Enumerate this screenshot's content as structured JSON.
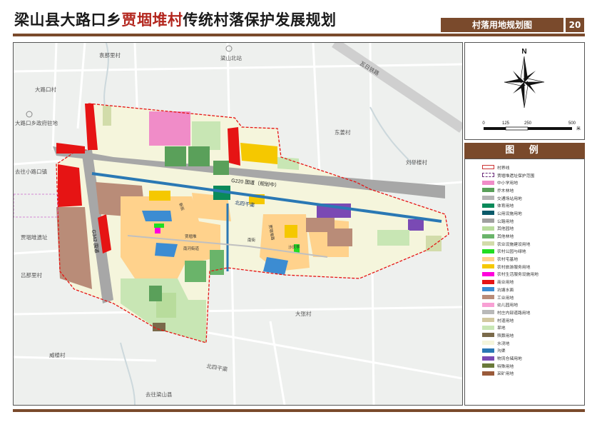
{
  "header": {
    "title_prefix": "梁山县大路口乡",
    "title_highlight": "贾堌堆村",
    "title_suffix": "传统村落保护发展规划",
    "map_name": "村落用地规划图",
    "page_number": "20"
  },
  "colors": {
    "brand": "#7a4a2c",
    "title_highlight": "#b3261e"
  },
  "map": {
    "labels": {
      "yuanna": "袁那里村",
      "lianshan_north": "梁山北站",
      "wagu": "瓦日铁路",
      "daluko_village": "大路口村",
      "gov": "大路口乡政府驻地",
      "dongjiang": "东姜村",
      "liuju": "刘举楼村",
      "to_daluko_town": "去往小路口镇",
      "g220": "G220 国道（规划中）",
      "beisi": "北四干渠",
      "g342": "G342 国道",
      "jiagudui_site": "贾堌堆遗址",
      "lvna": "吕那里村",
      "shaqing": "沙庆李",
      "dazhang": "大张村",
      "weilou": "威楼村",
      "beiwu": "北四干渠",
      "to_lianshan": "去往梁山县",
      "jiagu_village": "贾堌堆",
      "nanhe_road": "南河街道",
      "nanjie": "南街",
      "xinjie": "新街",
      "road_small": "贾堌堆路"
    }
  },
  "compass": {
    "north": "N",
    "scale_ticks": [
      "0",
      "125",
      "250",
      "500"
    ],
    "scale_unit": "米"
  },
  "legend": {
    "heading": "图  例",
    "items": [
      {
        "label": "村界线",
        "color": "#ffffff",
        "style": "boundary-solid"
      },
      {
        "label": "贾堌堆遗址保护范围",
        "color": "#ffffff",
        "style": "boundary-dashed"
      },
      {
        "label": "中小学用地",
        "color": "#f08cc8",
        "style": "fill"
      },
      {
        "label": "乔木林地",
        "color": "#5aa05a",
        "style": "fill"
      },
      {
        "label": "交通场站用地",
        "color": "#b4b4b4",
        "style": "fill"
      },
      {
        "label": "体育用地",
        "color": "#0a8a5a",
        "style": "fill"
      },
      {
        "label": "公用设施用地",
        "color": "#0a5a6a",
        "style": "fill"
      },
      {
        "label": "公路用地",
        "color": "#a0a0a0",
        "style": "fill"
      },
      {
        "label": "其他园地",
        "color": "#b8dc9c",
        "style": "fill"
      },
      {
        "label": "其他林地",
        "color": "#6ab46a",
        "style": "fill"
      },
      {
        "label": "农业设施建设用地",
        "color": "#d2dcaa",
        "style": "fill"
      },
      {
        "label": "农村公园与绿地",
        "color": "#22dd22",
        "style": "fill"
      },
      {
        "label": "农村宅基地",
        "color": "#ffd28c",
        "style": "fill"
      },
      {
        "label": "农村旅游服务用地",
        "color": "#f5c800",
        "style": "fill"
      },
      {
        "label": "农村生活服务设施用地",
        "color": "#ff00dc",
        "style": "fill"
      },
      {
        "label": "商业用地",
        "color": "#e61414",
        "style": "fill"
      },
      {
        "label": "坑塘水面",
        "color": "#3c8cd2",
        "style": "fill"
      },
      {
        "label": "工业用地",
        "color": "#b98c78",
        "style": "fill"
      },
      {
        "label": "幼儿园用地",
        "color": "#f8a0d4",
        "style": "fill"
      },
      {
        "label": "村庄内部道路用地",
        "color": "#b9b9b9",
        "style": "fill"
      },
      {
        "label": "村道用地",
        "color": "#d2c8a0",
        "style": "fill"
      },
      {
        "label": "旱地",
        "color": "#c8e6b4",
        "style": "fill"
      },
      {
        "label": "殡葬用地",
        "color": "#7a6a4a",
        "style": "fill"
      },
      {
        "label": "水浇地",
        "color": "#f5f5dc",
        "style": "fill"
      },
      {
        "label": "沟渠",
        "color": "#2a78b4",
        "style": "fill"
      },
      {
        "label": "物流仓储用地",
        "color": "#7a4ab4",
        "style": "fill"
      },
      {
        "label": "特殊用地",
        "color": "#6a7a3a",
        "style": "fill"
      },
      {
        "label": "采矿用地",
        "color": "#9a5a3a",
        "style": "fill"
      }
    ]
  }
}
